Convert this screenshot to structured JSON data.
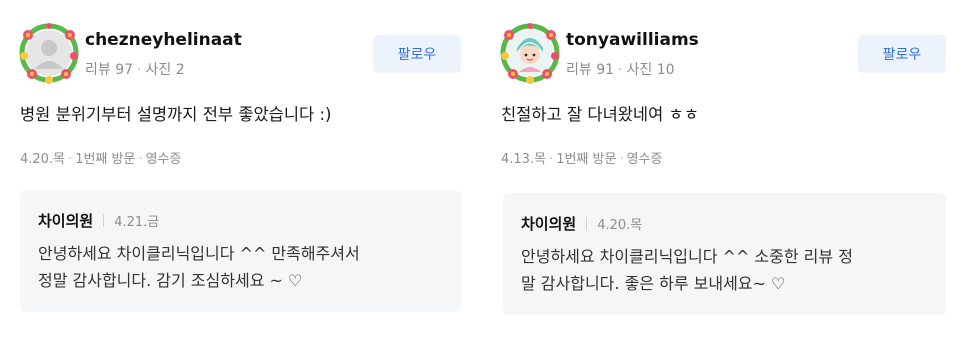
{
  "reviews": [
    {
      "username": "chezneyhelinaat",
      "review_count": "리뷰 97",
      "photo_count": "사진 2",
      "follow_label": "팔로우",
      "text": "병원 분위기부터 설명까지 전부 좋았습니다 :)",
      "visit_date": "4.20.목",
      "visit_count": "1번째 방문",
      "receipt": "영수증",
      "reply": {
        "author": "차이의원",
        "date": "4.21.금",
        "line1": "안녕하세요 차이클리닉입니다 ^^ 만족해주셔서",
        "line2": "정말 감사합니다. 감기 조심하세요 ~ ♡"
      }
    },
    {
      "username": "tonyawilliams",
      "review_count": "리뷰 91",
      "photo_count": "사진 10",
      "follow_label": "팔로우",
      "text": "친절하고 잘 다녀왔네여 ㅎㅎ",
      "visit_date": "4.13.목",
      "visit_count": "1번째 방문",
      "receipt": "영수증",
      "reply": {
        "author": "차이의원",
        "date": "4.20.목",
        "line1": "안녕하세요 차이클리닉입니다 ^^ 소중한 리뷰 정",
        "line2": "말 감사합니다. 좋은 하루 보내세요~ ♡"
      }
    }
  ],
  "colors": {
    "follow_bg": "#edf3fd",
    "follow_text": "#2f6fdd",
    "reply_bg": "#f5f6f7",
    "meta_text": "#8d8d8d",
    "wreath_green": "#58b84a",
    "flower_pink": "#ef4f6c",
    "flower_yellow": "#f6c93b"
  },
  "icons": [
    "flower-wreath-icon",
    "default-avatar-icon",
    "character-avatar-icon"
  ]
}
